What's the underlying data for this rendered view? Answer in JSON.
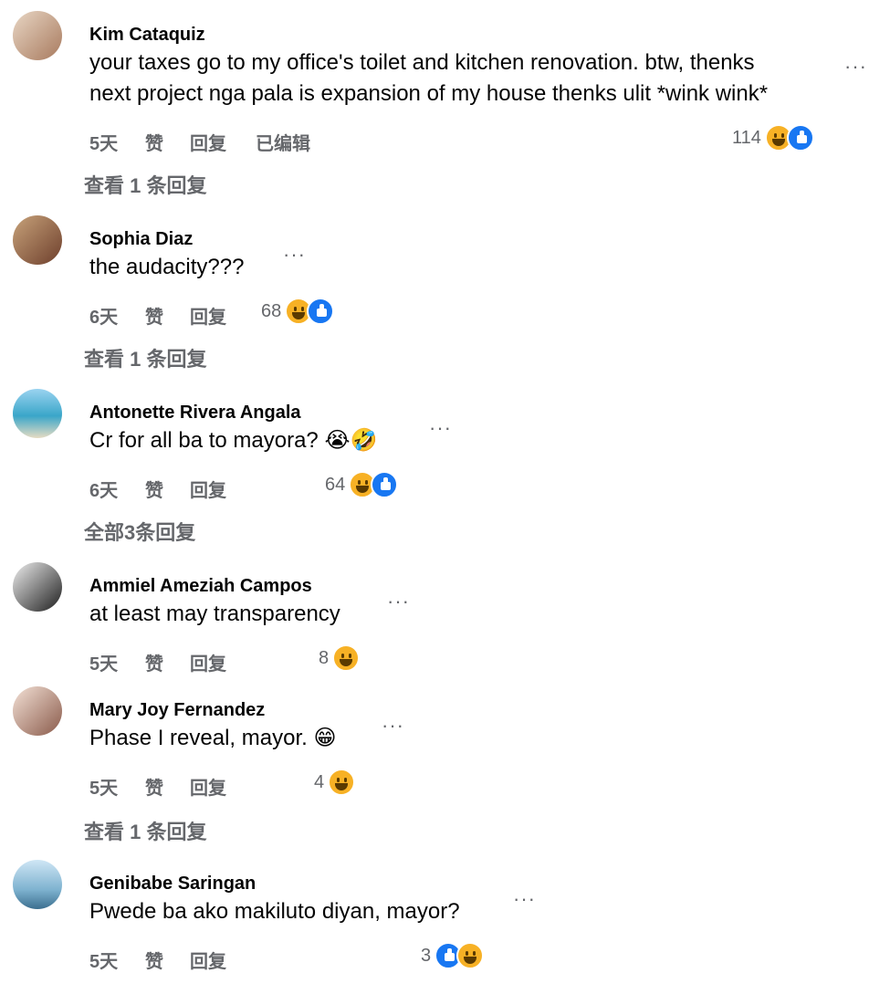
{
  "comments": [
    {
      "name": "Kim Cataquiz",
      "lines": [
        "your taxes go to my office's toilet and kitchen renovation. btw, thenks",
        "next project nga pala is expansion of my house thenks ulit *wink wink*"
      ],
      "time": "5天",
      "like": "赞",
      "reply": "回复",
      "edited": "已编辑",
      "count": "114",
      "view_replies": "查看 1 条回复",
      "avatar_color": "#c9a58a"
    },
    {
      "name": "Sophia Diaz",
      "lines": [
        "the audacity???"
      ],
      "time": "6天",
      "like": "赞",
      "reply": "回复",
      "count": "68",
      "view_replies": "查看 1 条回复",
      "avatar_color": "#8a5a44"
    },
    {
      "name": "Antonette Rivera Angala",
      "lines": [
        "Cr for all ba to mayora? 😭🤣"
      ],
      "time": "6天",
      "like": "赞",
      "reply": "回复",
      "count": "64",
      "view_replies": "全部3条回复",
      "avatar_color": "#3aa6c9"
    },
    {
      "name": "Ammiel Ameziah Campos",
      "lines": [
        "at least may transparency"
      ],
      "time": "5天",
      "like": "赞",
      "reply": "回复",
      "count": "8",
      "avatar_color": "#2b2b2b"
    },
    {
      "name": "Mary Joy Fernandez",
      "lines": [
        "Phase I reveal, mayor. 😁"
      ],
      "time": "5天",
      "like": "赞",
      "reply": "回复",
      "count": "4",
      "view_replies": "查看 1 条回复",
      "avatar_color": "#d9b8a8"
    },
    {
      "name": "Genibabe Saringan",
      "lines": [
        "Pwede ba ako makiluto diyan, mayor?"
      ],
      "time": "5天",
      "like": "赞",
      "reply": "回复",
      "count": "3",
      "avatar_color": "#6f9fbf"
    }
  ],
  "more_icon": "···"
}
